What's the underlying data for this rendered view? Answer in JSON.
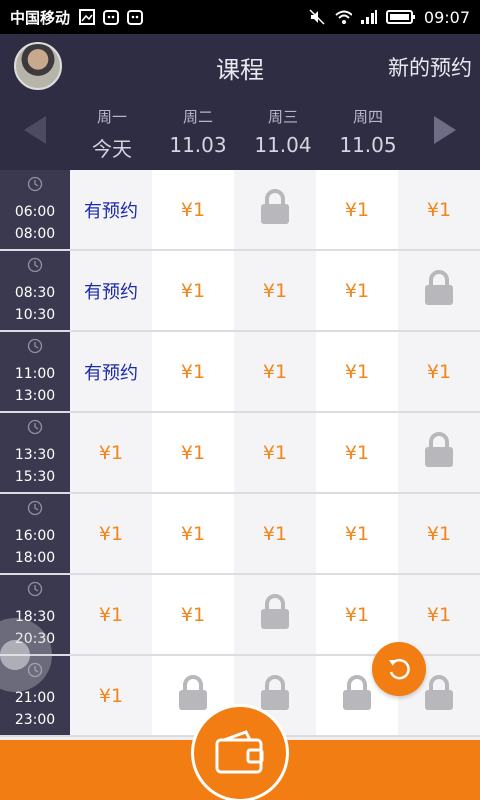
{
  "status_bar": {
    "carrier": "中国移动",
    "time": "09:07",
    "left_icons": [
      "image-icon",
      "cat-icon",
      "cat-icon"
    ],
    "right_icons": [
      "mute-icon",
      "wifi-icon",
      "signal-icon",
      "battery-icon"
    ]
  },
  "header": {
    "title": "课程",
    "new_booking": "新的预约",
    "days": [
      {
        "weekday": "周一",
        "date": "今天"
      },
      {
        "weekday": "周二",
        "date": "11.03"
      },
      {
        "weekday": "周三",
        "date": "11.04"
      },
      {
        "weekday": "周四",
        "date": "11.05"
      }
    ]
  },
  "schedule": [
    {
      "start": "06:00",
      "end": "08:00",
      "cells": [
        "有预约",
        "¥1",
        "lock",
        "¥1",
        "¥1"
      ]
    },
    {
      "start": "08:30",
      "end": "10:30",
      "cells": [
        "有预约",
        "¥1",
        "¥1",
        "¥1",
        "lock"
      ]
    },
    {
      "start": "11:00",
      "end": "13:00",
      "cells": [
        "有预约",
        "¥1",
        "¥1",
        "¥1",
        "¥1"
      ]
    },
    {
      "start": "13:30",
      "end": "15:30",
      "cells": [
        "¥1",
        "¥1",
        "¥1",
        "¥1",
        "lock"
      ]
    },
    {
      "start": "16:00",
      "end": "18:00",
      "cells": [
        "¥1",
        "¥1",
        "¥1",
        "¥1",
        "¥1"
      ]
    },
    {
      "start": "18:30",
      "end": "20:30",
      "cells": [
        "¥1",
        "¥1",
        "lock",
        "¥1",
        "¥1"
      ]
    },
    {
      "start": "21:00",
      "end": "23:00",
      "cells": [
        "¥1",
        "lock",
        "lock",
        "lock",
        "lock"
      ]
    }
  ],
  "colors": {
    "header_bg": "#2f2d43",
    "time_bg": "#3b394f",
    "accent_orange": "#f27d12",
    "booked_blue": "#1d2aa8",
    "lock_gray": "#b8b8bc"
  }
}
